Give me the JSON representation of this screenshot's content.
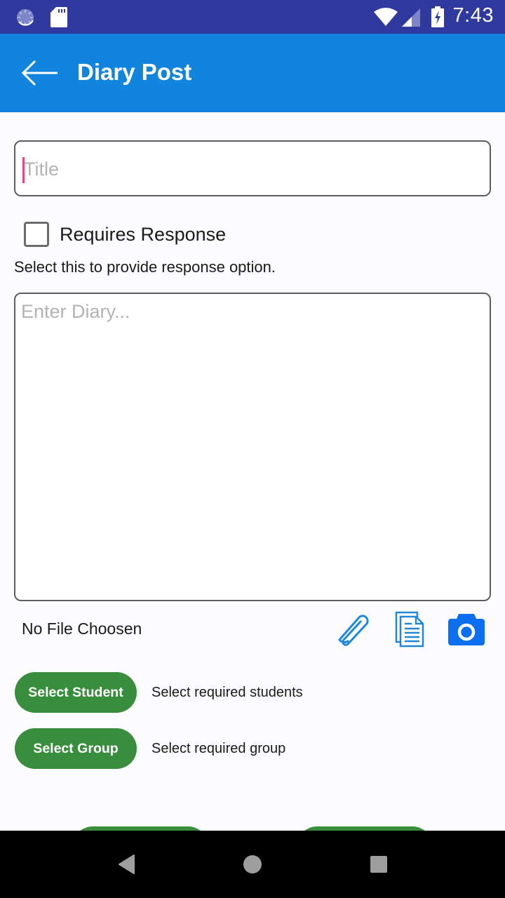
{
  "status_bar": {
    "time": "7:43",
    "left_icons": [
      "sync-icon",
      "sd-card-icon"
    ],
    "right_icons": [
      "wifi-icon",
      "cell-signal-icon",
      "battery-charging-icon"
    ]
  },
  "app_bar": {
    "title": "Diary Post",
    "back_icon": "arrow-back-icon"
  },
  "form": {
    "title_field": {
      "placeholder": "Title",
      "value": ""
    },
    "requires_response": {
      "label": "Requires Response",
      "checked": false
    },
    "helper_text": "Select this to provide response option.",
    "diary_field": {
      "placeholder": "Enter Diary...",
      "value": ""
    },
    "file_status": "No File Choosen",
    "attach_icons": [
      "paperclip-icon",
      "document-icon",
      "camera-icon"
    ],
    "select_student": {
      "label": "Select Student",
      "description": "Select required students"
    },
    "select_group": {
      "label": "Select Group",
      "description": "Select required group"
    }
  },
  "colors": {
    "status_bar": "#303a9e",
    "app_bar": "#1185de",
    "button_green": "#388e3c",
    "icon_blue": "#1f88d8",
    "camera_blue": "#0b6ff0",
    "caret_pink": "#e8457a"
  },
  "nav_bar": {
    "buttons": [
      "back",
      "home",
      "recents"
    ]
  }
}
